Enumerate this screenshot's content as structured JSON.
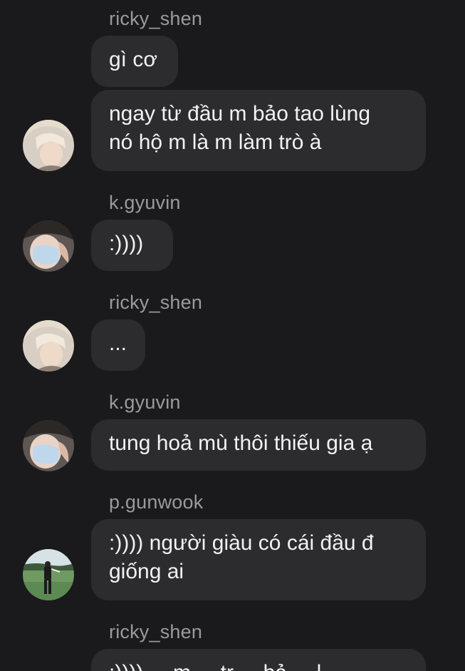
{
  "messages": [
    {
      "sender": "ricky_shen",
      "texts": [
        "gì cơ",
        "ngay từ đầu m bảo tao lùng\nnó hộ m là m làm trò à"
      ],
      "avatar": "ricky-avatar"
    },
    {
      "sender": "k.gyuvin",
      "texts": [
        ":))))"
      ],
      "avatar": "gyuvin-avatar"
    },
    {
      "sender": "ricky_shen",
      "texts": [
        "..."
      ],
      "avatar": "ricky-avatar"
    },
    {
      "sender": "k.gyuvin",
      "texts": [
        "tung hoả mù thôi thiếu gia ạ"
      ],
      "avatar": "gyuvin-avatar"
    },
    {
      "sender": "p.gunwook",
      "texts": [
        ":)))) người giàu có cái đầu đ\ngiống ai"
      ],
      "avatar": "gunwook-avatar"
    },
    {
      "sender": "ricky_shen",
      "texts": [
        ":)))) ... m ... tr ... bả ... l..."
      ],
      "avatar": "ricky-avatar"
    }
  ],
  "colors": {
    "background": "#1a1a1c",
    "bubble": "#2c2c2e",
    "sender_name": "#9a9a9e",
    "text": "#f2f2f2"
  }
}
